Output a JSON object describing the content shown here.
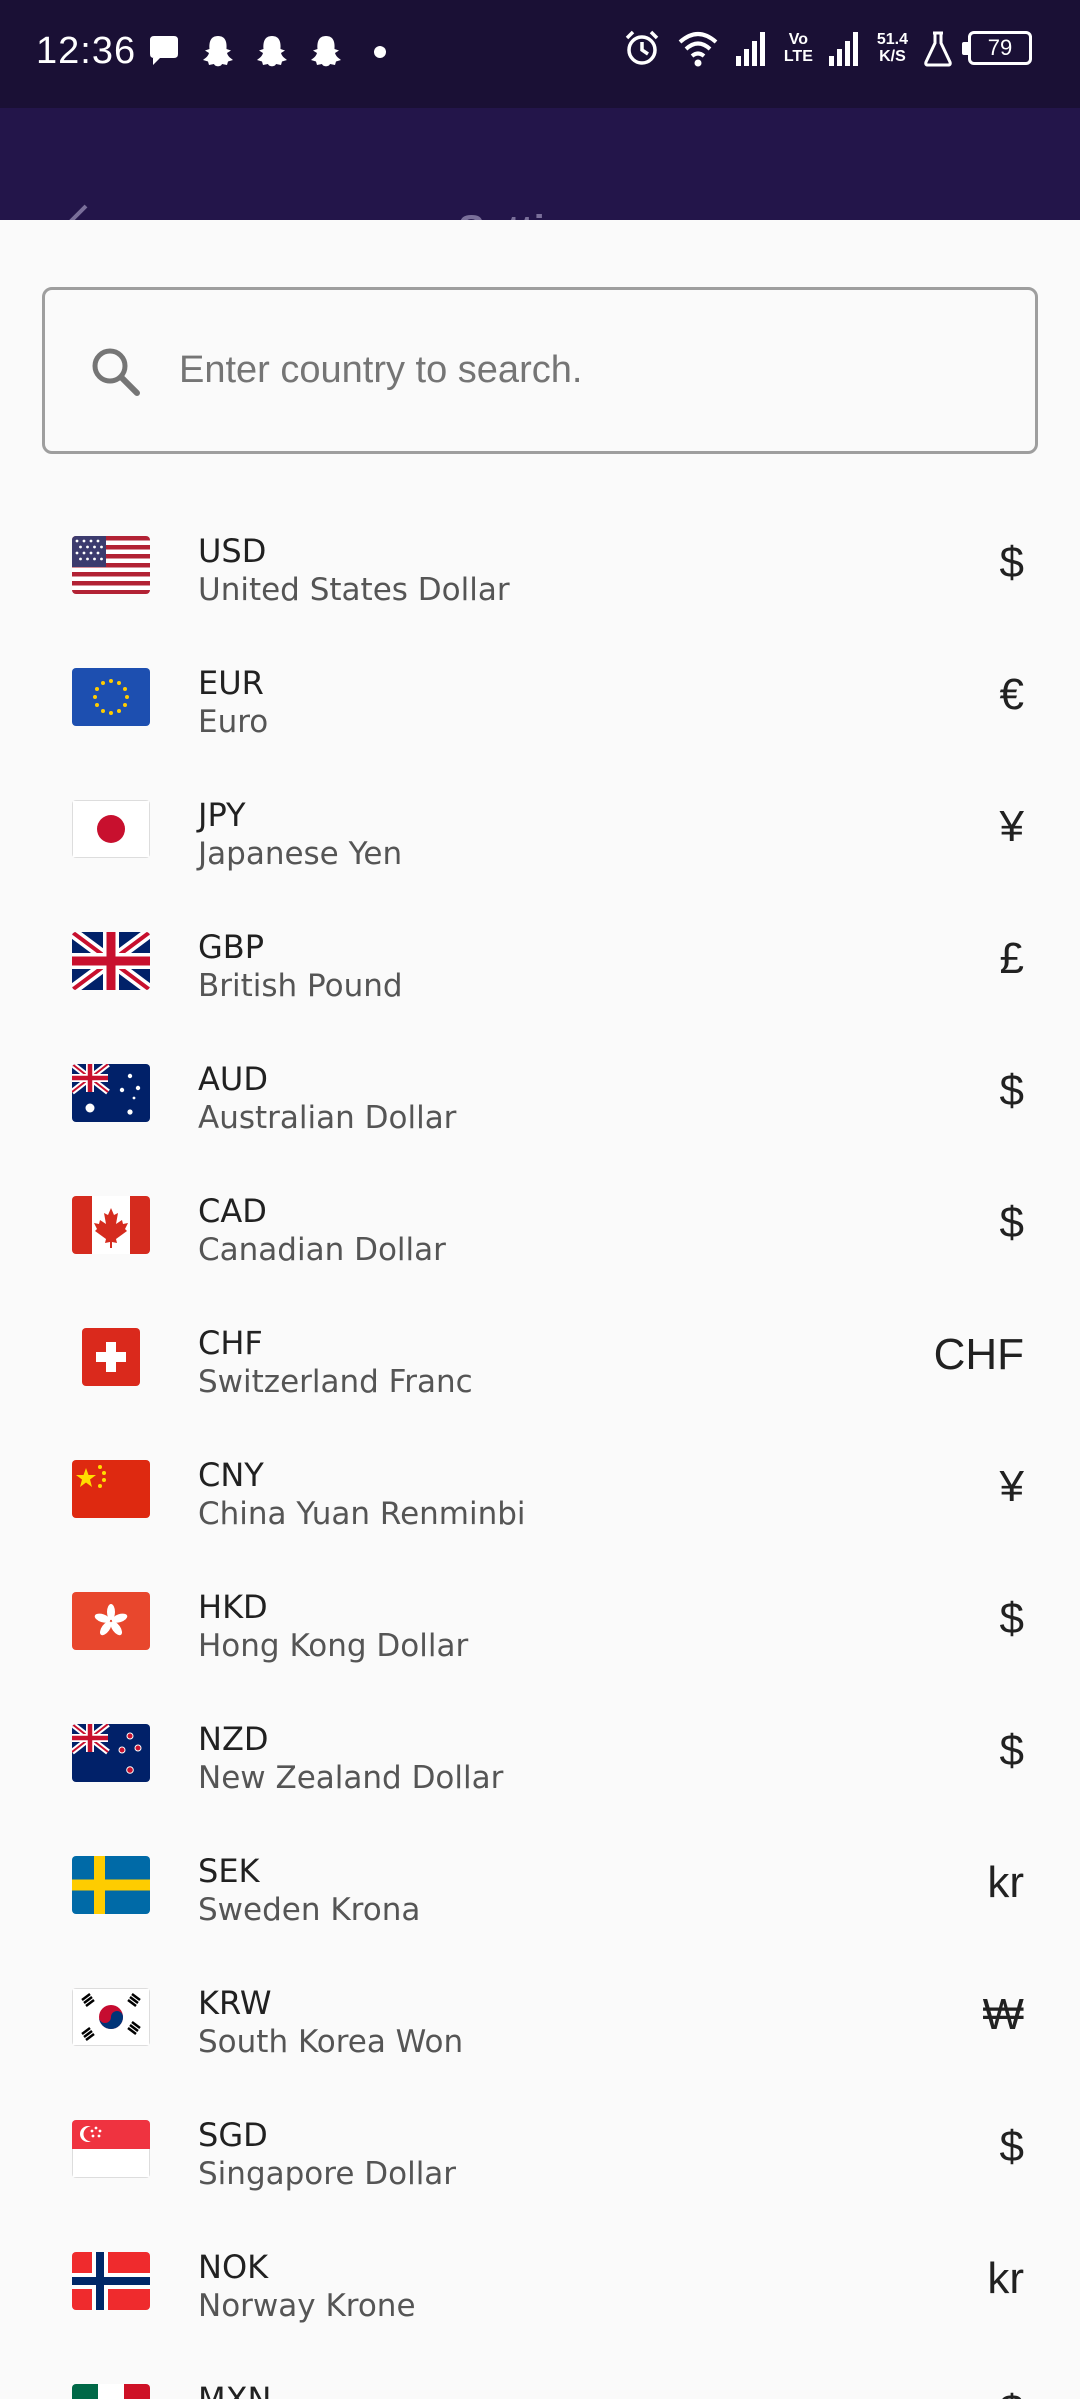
{
  "status_bar": {
    "time": "12:36",
    "network_speed_value": "51.4",
    "network_speed_unit": "K/S",
    "volte_top": "Vo",
    "volte_bottom": "LTE",
    "battery": "79"
  },
  "app_bar": {
    "title": "Setti"
  },
  "search": {
    "placeholder": "Enter country to search.",
    "value": ""
  },
  "currencies": [
    {
      "code": "USD",
      "name": "United States Dollar",
      "symbol": "$",
      "flag": "us-flag-icon"
    },
    {
      "code": "EUR",
      "name": "Euro",
      "symbol": "€",
      "flag": "eu-flag-icon"
    },
    {
      "code": "JPY",
      "name": "Japanese Yen",
      "symbol": "¥",
      "flag": "jp-flag-icon"
    },
    {
      "code": "GBP",
      "name": "British Pound",
      "symbol": "£",
      "flag": "gb-flag-icon"
    },
    {
      "code": "AUD",
      "name": "Australian Dollar",
      "symbol": "$",
      "flag": "au-flag-icon"
    },
    {
      "code": "CAD",
      "name": "Canadian Dollar",
      "symbol": "$",
      "flag": "ca-flag-icon"
    },
    {
      "code": "CHF",
      "name": "Switzerland Franc",
      "symbol": "CHF",
      "flag": "ch-flag-icon"
    },
    {
      "code": "CNY",
      "name": "China Yuan Renminbi",
      "symbol": "¥",
      "flag": "cn-flag-icon"
    },
    {
      "code": "HKD",
      "name": "Hong Kong Dollar",
      "symbol": "$",
      "flag": "hk-flag-icon"
    },
    {
      "code": "NZD",
      "name": "New Zealand Dollar",
      "symbol": "$",
      "flag": "nz-flag-icon"
    },
    {
      "code": "SEK",
      "name": "Sweden Krona",
      "symbol": "kr",
      "flag": "se-flag-icon"
    },
    {
      "code": "KRW",
      "name": "South Korea Won",
      "symbol": "₩",
      "flag": "kr-flag-icon"
    },
    {
      "code": "SGD",
      "name": "Singapore Dollar",
      "symbol": "$",
      "flag": "sg-flag-icon"
    },
    {
      "code": "NOK",
      "name": "Norway Krone",
      "symbol": "kr",
      "flag": "no-flag-icon"
    },
    {
      "code": "MXN",
      "name": "",
      "symbol": "$",
      "flag": "mx-flag-icon"
    }
  ]
}
